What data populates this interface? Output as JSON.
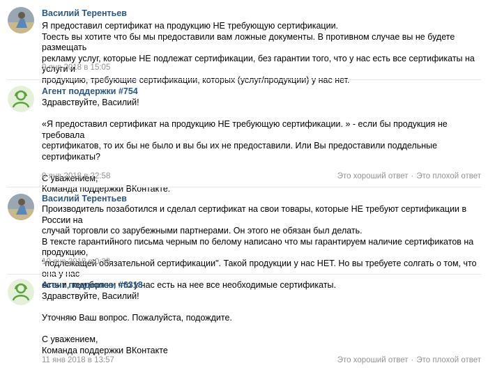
{
  "messages": [
    {
      "author": "Василий Терентьев",
      "avatar_icon": "user-photo-icon",
      "text": "Я предоставил сертификат на продукцию НЕ требующую сертификации.\nТоесть вы хотите что бы мы предоставили вам ложные документы. В противном случае вы не будете размещать\nрекламу услуг, которые НЕ подлежат сертификации, без гарантии того, что у нас есть все сертификаты на услуги и\nпродукцию, требующие сертификации, которых (услуг/продукции) у нас нет.",
      "date": "9 янв 2018 в 15:05"
    },
    {
      "author": "Агент поддержки #754",
      "avatar_icon": "support-agent-icon",
      "text": "Здравствуйте, Василий!\n\n«Я предоставил сертификат на продукцию НЕ требующую сертификации. » - если бы продукция не требовала\nсертификатов, то их бы не было и вы бы их не предоставили. Или Вы предоставили поддельные сертификаты?\n\nС уважением,\nКоманда поддержки ВКонтакте.",
      "date": "9 янв 2018 в 22:58",
      "good_answer": "Это хороший ответ",
      "bad_answer": "Это плохой ответ",
      "separator": "·"
    },
    {
      "author": "Василий Терентьев",
      "avatar_icon": "user-photo-icon",
      "text": "Производитель позаботился и сделал сертификат на свои товары, которые НЕ требуют сертификации в России на\nслучай торговли со зарубежными партнерами. Он этого не обязан был делать.\nВ тексте гарантийного письма черным по белому написано что мы гарантируем наличие сертификатов на продукцию,\n\"подлежащей обязательной сертификации\". Такой продукции у нас НЕТ. Но вы требуете солгать о том, что она у нас\nесть и, тем более, что у нас есть на нее все необходимые сертификаты.",
      "date": "10 янв 2018 в 0:38"
    },
    {
      "author": "Агент поддержки #6318",
      "avatar_icon": "support-agent-icon",
      "text": "Здравствуйте, Василий!\n\nУточняю Ваш вопрос. Пожалуйста, подождите.\n\nС уважением,\nКоманда поддержки ВКонтакте",
      "date": "11 янв 2018 в 13:57",
      "good_answer": "Это хороший ответ",
      "bad_answer": "Это плохой ответ",
      "separator": "·"
    }
  ],
  "colors": {
    "author": "#2a5885",
    "meta": "#939393",
    "divider": "#e7e8ec",
    "agent_avatar_bg": "#e4f0d9",
    "agent_avatar_fg": "#5ca33a"
  }
}
